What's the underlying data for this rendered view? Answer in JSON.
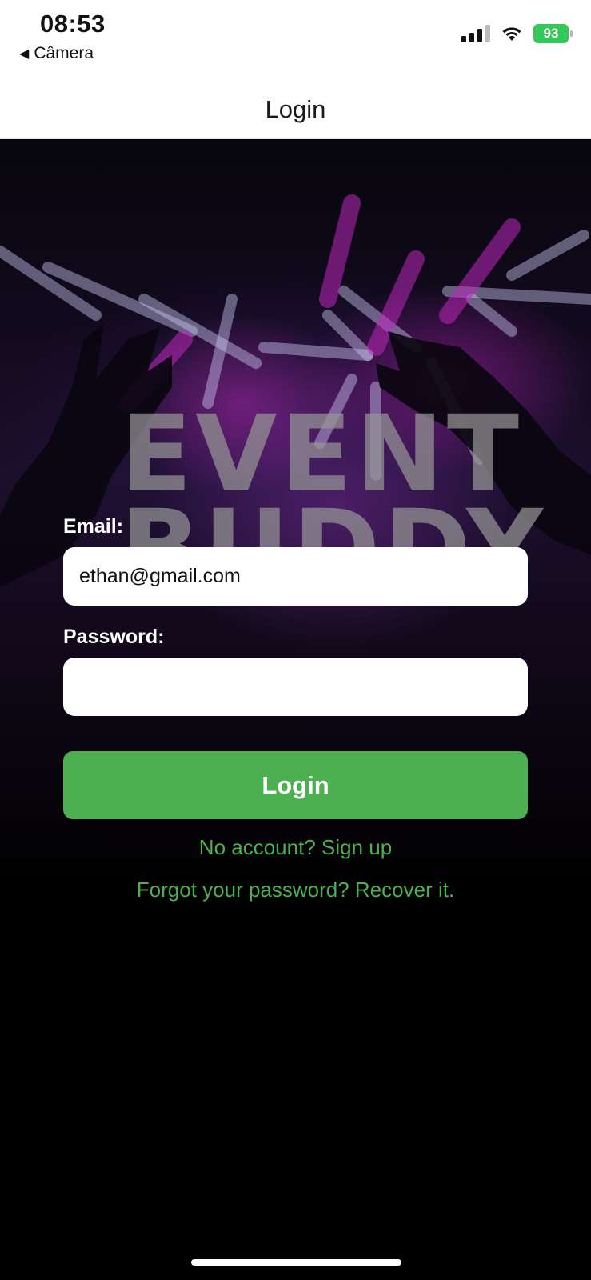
{
  "status_bar": {
    "time": "08:53",
    "back_app": "Câmera",
    "battery": "93"
  },
  "nav": {
    "title": "Login"
  },
  "hero": {
    "wordmark_line1": "EVENT",
    "wordmark_line2": "BUDDY"
  },
  "form": {
    "email_label": "Email:",
    "email_value": "ethan@gmail.com",
    "password_label": "Password:",
    "password_value": "",
    "login_button": "Login"
  },
  "links": {
    "signup": "No account? Sign up",
    "recover": "Forgot your password? Recover it."
  },
  "colors": {
    "accent": "#4caf50",
    "battery": "#34c759",
    "background": "#000000"
  }
}
